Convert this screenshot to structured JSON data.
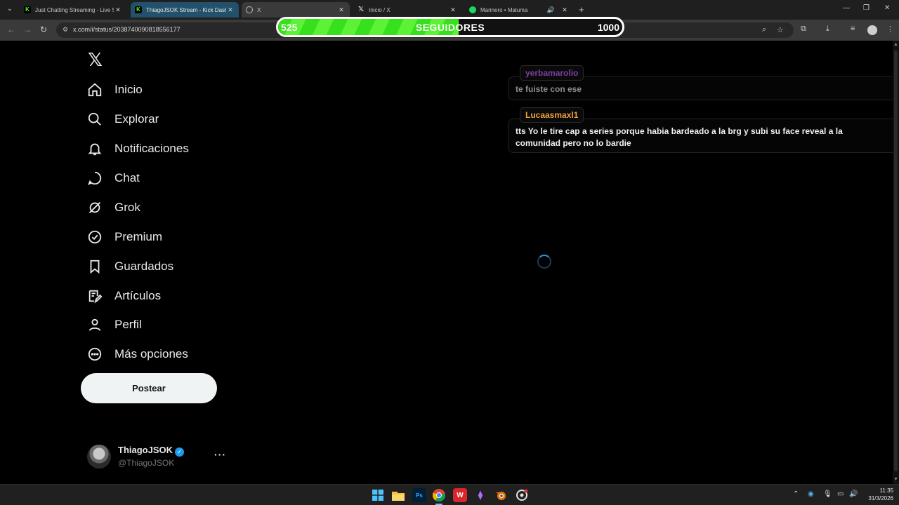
{
  "browser": {
    "tabs": [
      {
        "title": "Just Chatting Streaming - Live S",
        "favicon": "kick-icon"
      },
      {
        "title": "ThiagoJSOK Stream - Kick Dash",
        "favicon": "kick-icon"
      },
      {
        "title": "X",
        "favicon": "globe-icon"
      },
      {
        "title": "Inicio / X",
        "favicon": "x-icon"
      },
      {
        "title": "Marinero • Maluma",
        "favicon": "spotify-icon"
      }
    ],
    "url": "x.com/i/status/2038740090818556177"
  },
  "goal": {
    "current": "525",
    "label": "SEGUIDORES",
    "max": "1000",
    "progress": 0.525,
    "fill_color": "#4ae82a"
  },
  "sidebar": {
    "items": [
      {
        "label": "Inicio",
        "icon": "home-icon"
      },
      {
        "label": "Explorar",
        "icon": "search-icon"
      },
      {
        "label": "Notificaciones",
        "icon": "bell-icon"
      },
      {
        "label": "Chat",
        "icon": "chat-icon"
      },
      {
        "label": "Grok",
        "icon": "grok-icon"
      },
      {
        "label": "Premium",
        "icon": "verified-badge-icon"
      },
      {
        "label": "Guardados",
        "icon": "bookmark-icon"
      },
      {
        "label": "Artículos",
        "icon": "article-icon"
      },
      {
        "label": "Perfil",
        "icon": "person-icon"
      },
      {
        "label": "Más opciones",
        "icon": "more-circle-icon"
      }
    ],
    "post_label": "Postear"
  },
  "profile": {
    "name": "ThiagoJSOK",
    "handle": "@ThiagoJSOK",
    "more": "···"
  },
  "chat": {
    "messages": [
      {
        "user": "yerbamarolio",
        "text": "te fuiste con ese",
        "user_color": "#7b3fa6",
        "text_color": "#8f8f8f"
      },
      {
        "user": "Lucaasmaxl1",
        "text": "tts Yo le tire cap a series porque habia bardeado a la brg y subi su face reveal a la comunidad pero no lo bardie",
        "user_color": "#f0a040",
        "text_color": "#f2f2f2"
      }
    ]
  },
  "taskbar": {
    "apps": [
      "windows-start-icon",
      "file-explorer-icon",
      "photoshop-icon",
      "chrome-icon",
      "wps-office-icon",
      "game-launcher-icon",
      "blender-icon",
      "obs-icon"
    ],
    "time": "11:35",
    "date": "31/3/2026"
  }
}
